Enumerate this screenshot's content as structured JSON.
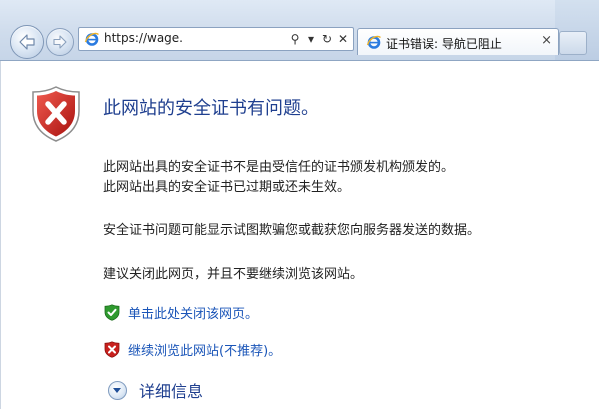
{
  "browser": {
    "url": "https://wage.",
    "tab_title": "证书错误: 导航已阻止",
    "tab_close_glyph": "×",
    "tools": {
      "search_glyph": "⚲",
      "dropdown_glyph": "▾",
      "refresh_glyph": "↻",
      "stop_glyph": "✕"
    }
  },
  "page": {
    "heading": "此网站的安全证书有问题。",
    "paragraphs": {
      "untrusted": "此网站出具的安全证书不是由受信任的证书颁发机构颁发的。",
      "expired": "此网站出具的安全证书已过期或还未生效。",
      "risk": "安全证书问题可能显示试图欺骗您或截获您向服务器发送的数据。",
      "recommend": "建议关闭此网页，并且不要继续浏览该网站。"
    },
    "options": {
      "close_page": "单击此处关闭该网页。",
      "continue": "继续浏览此网站(不推荐)。"
    },
    "more_info": "详细信息"
  },
  "colors": {
    "heading": "#1f3f8f",
    "link": "#1a55b8",
    "shield_red": "#c8201d",
    "shield_green": "#2f9a2f"
  },
  "icons": {
    "big_shield": "error-shield-icon",
    "close_shield": "safe-shield-icon",
    "continue_shield": "unsafe-shield-icon",
    "more_info": "expand-chevron-icon"
  }
}
